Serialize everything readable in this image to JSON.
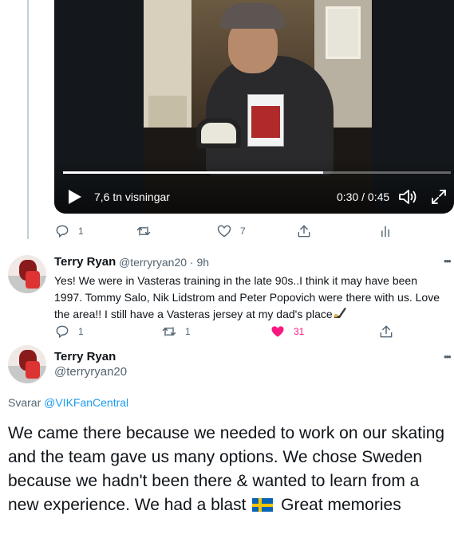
{
  "video": {
    "views": "7,6 tn visningar",
    "time": "0:30 / 0:45",
    "progress": 0.67
  },
  "tweet1_actions": {
    "reply_count": "1",
    "like_count": "7"
  },
  "reply": {
    "name": "Terry Ryan",
    "meta": "@terryryan20 · 9h",
    "lines": [
      "Yes! We were in Vasteras training in the late 90s..I think it may have been",
      "1997. Tommy Salo, Nik Lidstrom and Peter Popovich were there with us. Love",
      "the area!! I still have a Vasteras jersey at my dad's place"
    ],
    "reply_count": "1",
    "retweet_count": "1",
    "like_count": "31",
    "like_color": "#f91880"
  },
  "main": {
    "name": "Terry Ryan",
    "handle": "@terryryan20",
    "reply_prefix": "Svarar",
    "reply_handle": "@VIKFanCentral",
    "text_before_flag": "We came there because we needed to work on our skating and the team gave us many options. We chose Sweden because we hadn't been there & wanted to learn from a new experience. We had a blast",
    "text_after_flag": "Great memories"
  },
  "icons": [
    "play-icon",
    "volume-icon",
    "fullscreen-icon",
    "reply-icon",
    "retweet-icon",
    "like-icon",
    "share-icon",
    "analytics-icon",
    "more-icon",
    "hockey-emoji-icon",
    "swedish-flag-icon"
  ],
  "colors": {
    "link": "#1d9bf0",
    "muted": "#536471",
    "like": "#f91880"
  }
}
